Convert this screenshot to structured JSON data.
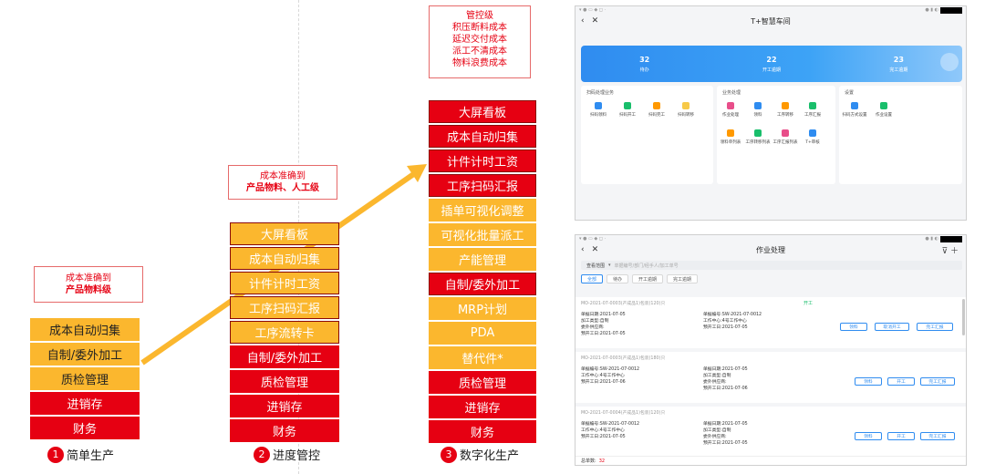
{
  "diagram": {
    "stage1": {
      "number": "1",
      "label": "简单生产",
      "note_line1": "成本准确到",
      "note_line2": "产品物料级",
      "blocks": [
        "成本自动归集",
        "自制/委外加工",
        "质检管理",
        "进销存",
        "财务"
      ]
    },
    "stage2": {
      "number": "2",
      "label": "进度管控",
      "note_line1": "成本准确到",
      "note_line2": "产品物料、人工级",
      "blocks": [
        "大屏看板",
        "成本自动归集",
        "计件计时工资",
        "工序扫码汇报",
        "工序流转卡",
        "自制/委外加工",
        "质检管理",
        "进销存",
        "财务"
      ]
    },
    "stage3": {
      "number": "3",
      "label": "数字化生产",
      "note_lines": [
        "管控级",
        "积压断料成本",
        "延迟交付成本",
        "派工不清成本",
        "物料浪费成本"
      ],
      "blocks": [
        "大屏看板",
        "成本自动归集",
        "计件计时工资",
        "工序扫码汇报",
        "插单可视化调整",
        "可视化批量派工",
        "产能管理",
        "自制/委外加工",
        "MRP计划",
        "PDA",
        "替代件*",
        "质检管理",
        "进销存",
        "财务"
      ]
    },
    "colors": {
      "red": "#e60012",
      "yellow": "#fbb72e",
      "arrow": "#fbb72e"
    }
  },
  "app1": {
    "title": "T+智慧车间",
    "back_icon": "chevron-left-icon",
    "close_icon": "close-icon",
    "stats": [
      {
        "value": "32",
        "label": "待办"
      },
      {
        "value": "22",
        "label": "开工逾期"
      },
      {
        "value": "23",
        "label": "完工逾期"
      }
    ],
    "sections": [
      {
        "title": "扫码处理业务",
        "items": [
          "扫码领料",
          "扫码开工",
          "扫码完工",
          "扫码转移"
        ]
      },
      {
        "title": "业务处理",
        "items": [
          "作业处理",
          "领料",
          "工序转移",
          "工序汇报",
          "领料单列表",
          "工序转移列表",
          "工序汇报列表",
          "T+审核"
        ]
      },
      {
        "title": "设置",
        "items": [
          "扫码方式设置",
          "作业设置"
        ]
      }
    ]
  },
  "app2": {
    "title": "作业处理",
    "search_label": "查看范围",
    "search_placeholder": "单据编号/部门/经手人/加工单号",
    "tabs": [
      "全部",
      "待办",
      "开工逾期",
      "完工逾期"
    ],
    "records": [
      {
        "header": "MO-2021-07-0003(产成品1)包装(120)只",
        "status": "开工",
        "left": [
          "单据日期:2021-07-05",
          "加工类型:自制",
          "委外供应商:",
          "预开工日:2021-07-05"
        ],
        "right": [
          "单据编号:SW-2021-07-0012",
          "工作中心:4号工作中心",
          "预开工日:2021-07-05"
        ],
        "buttons": [
          "领料",
          "取消开工",
          "完工汇报"
        ]
      },
      {
        "header": "MO-2021-07-0003(产成品1)包装(180)只",
        "status": "",
        "left": [
          "单据编号:SW-2021-07-0012",
          "工作中心:4号工作中心",
          "预开工日:2021-07-06"
        ],
        "right": [
          "单据日期:2021-07-05",
          "加工类型:自制",
          "委外供应商:",
          "预开工日:2021-07-06"
        ],
        "buttons": [
          "领料",
          "开工",
          "完工汇报"
        ]
      },
      {
        "header": "MO-2021-07-0004(产成品1)包装(120)只",
        "status": "",
        "left": [
          "单据编号:SW-2021-07-0012",
          "工作中心:4号工作中心",
          "预开工日:2021-07-05"
        ],
        "right": [
          "单据日期:2021-07-05",
          "加工类型:自制",
          "委外供应商:",
          "预开工日:2021-07-05"
        ],
        "buttons": [
          "领料",
          "开工",
          "完工汇报"
        ]
      }
    ],
    "footer_label": "总单数:",
    "footer_value": "32"
  }
}
